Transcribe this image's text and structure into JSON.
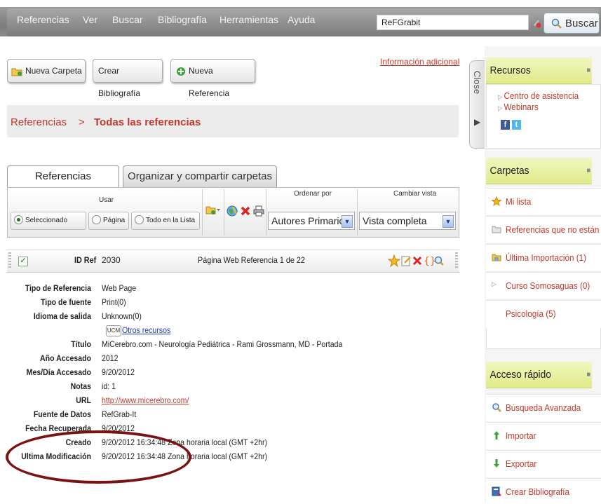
{
  "menu": {
    "items": [
      "Referencias",
      "Ver",
      "Buscar",
      "Bibliografía",
      "Herramientas",
      "Ayuda"
    ],
    "search_value": "ReFGrabit",
    "search_button": "Buscar"
  },
  "toolbar": {
    "new_folder": "Nueva Carpeta",
    "create_bibliography": "Crear Bibliografía",
    "new_reference": "Nueva Referencia",
    "info_link": "Información adicional"
  },
  "breadcrumb": {
    "root": "Referencias",
    "separator": ">",
    "current": "Todas las referencias"
  },
  "close_tab": "Close",
  "tabs": [
    "Referencias",
    "Organizar y compartir carpetas"
  ],
  "actions": {
    "usar_label": "Usar",
    "radios": [
      "Seleccionado",
      "Página",
      "Todo en la Lista"
    ],
    "sort_label": "Ordenar por",
    "sort_value": "Autores Primarios",
    "view_label": "Cambiar vista",
    "view_value": "Vista completa"
  },
  "record": {
    "id_label": "ID Ref",
    "id_value": "2030",
    "type_page": "Página Web Referencia 1 de 22"
  },
  "details": {
    "tipo_ref_label": "Tipo de Referencia",
    "tipo_ref": "Web Page",
    "tipo_fuente_label": "Tipo de fuente",
    "tipo_fuente": "Print(0)",
    "idioma_label": "Idioma de salida",
    "idioma": "Unknown(0)",
    "otros_badge": "UCM",
    "otros": "Otros recursos",
    "titulo_label": "Título",
    "titulo": "MiCerebro.com - Neurología Pediátrica - Rami Grossmann, MD - Portada",
    "anio_label": "Año Accesado",
    "anio": "2012",
    "mesdia_label": "Mes/Día Accesado",
    "mesdia": "9/20/2012",
    "notas_label": "Notas",
    "notas": "id: 1",
    "url_label": "URL",
    "url": "http://www.micerebro.com/",
    "fuente_label": "Fuente de Datos",
    "fuente": "RefGrab-It",
    "fecha_label": "Fecha Recuperada",
    "fecha": "9/20/2012",
    "creado_label": "Creado",
    "creado": "9/20/2012 16:34:48 Zona horaria local (GMT +2hr)",
    "ultima_label": "Ultima Modificación",
    "ultima": "9/20/2012 16:34:48 Zona horaria local (GMT +2hr)"
  },
  "sidebar": {
    "recursos_title": "Recursos",
    "recursos": [
      "Centro de asistencia",
      "Webinars"
    ],
    "carpetas_title": "Carpetas",
    "carpetas": [
      {
        "label": "Mi lista",
        "icon": "star-icon"
      },
      {
        "label": "Referencias que no están e",
        "icon": "folder-icon"
      },
      {
        "label": "Última Importación  (1)",
        "icon": "import-folder-icon"
      },
      {
        "label": "Curso Somosaguas  (0)",
        "icon": "expand-icon"
      },
      {
        "label": "Psicología  (5)",
        "icon": ""
      }
    ],
    "acceso_title": "Acceso rápido",
    "acceso": [
      {
        "label": "Búsqueda Avanzada",
        "icon": "search-icon"
      },
      {
        "label": "Importar",
        "icon": "arrow-up-icon"
      },
      {
        "label": "Exportar",
        "icon": "arrow-down-icon"
      },
      {
        "label": "Crear Bibliografía",
        "icon": "bibliography-icon"
      }
    ]
  },
  "colors": {
    "accent_red": "#c0392b",
    "link_blue": "#1f3fb5",
    "panel_head": "#e0ea8a",
    "annotation": "#7a1212"
  }
}
